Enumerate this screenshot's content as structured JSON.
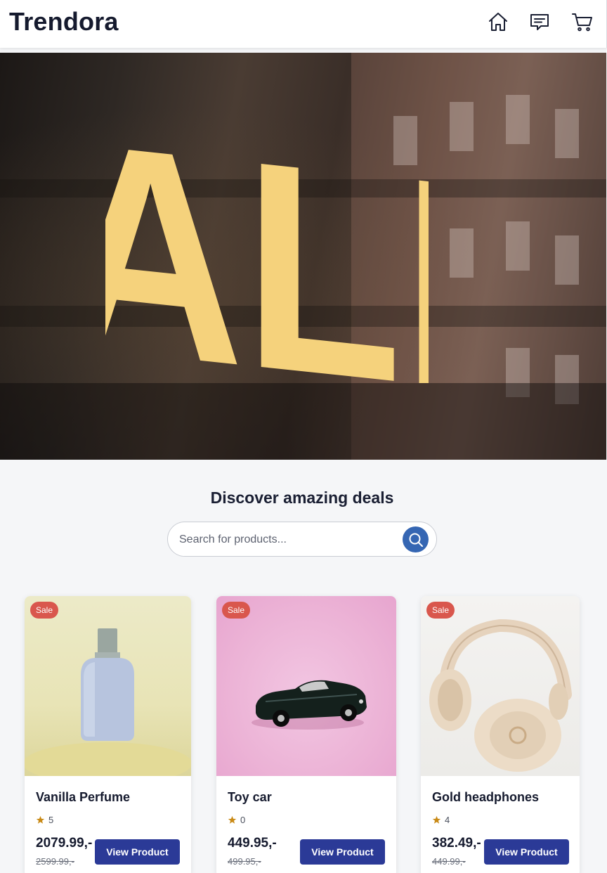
{
  "header": {
    "logo": "Trendora",
    "icons": [
      "home-icon",
      "chat-icon",
      "cart-icon"
    ]
  },
  "hero": {
    "sign_text": "SALE",
    "sign_color": "#f5d27c"
  },
  "deals": {
    "title": "Discover amazing deals",
    "search_placeholder": "Search for products..."
  },
  "colors": {
    "primary_button": "#2b3a97",
    "search_button": "#3566b3",
    "sale_badge": "#d9574d",
    "star": "#c98a16"
  },
  "products": [
    {
      "badge": "Sale",
      "name": "Vanilla Perfume",
      "rating": "5",
      "price": "2079.99,-",
      "old_price": "2599.99,-",
      "button": "View Product",
      "image_icon": "perfume-bottle-icon"
    },
    {
      "badge": "Sale",
      "name": "Toy car",
      "rating": "0",
      "price": "449.95,-",
      "old_price": "499.95,-",
      "button": "View Product",
      "image_icon": "toy-car-icon"
    },
    {
      "badge": "Sale",
      "name": "Gold headphones",
      "rating": "4",
      "price": "382.49,-",
      "old_price": "449.99,-",
      "button": "View Product",
      "image_icon": "headphones-icon"
    }
  ]
}
